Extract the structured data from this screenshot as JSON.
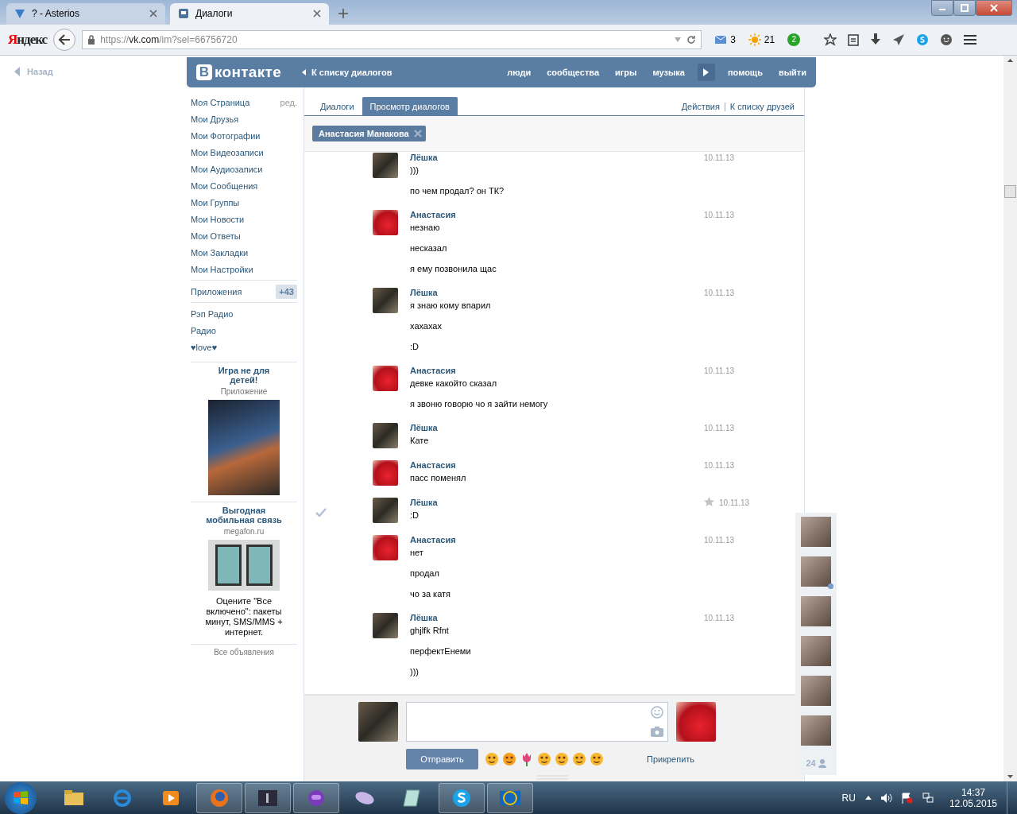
{
  "browser": {
    "tabs": [
      {
        "title": "? - Asterios",
        "selected": false
      },
      {
        "title": "Диалоги",
        "selected": true
      }
    ],
    "logo": "Яндекс",
    "url": "https://**vk.com**/im?sel=66756720",
    "counters": [
      {
        "kind": "mail",
        "value": "3"
      },
      {
        "kind": "weather",
        "value": "21"
      },
      {
        "kind": "badge",
        "value": "2"
      }
    ]
  },
  "back_link": "Назад",
  "header": {
    "logo_letter": "В",
    "logo_text": "контакте",
    "back": "К списку диалогов",
    "nav": [
      "люди",
      "сообщества",
      "игры",
      "музыка"
    ],
    "nav_after": [
      "помощь",
      "выйти"
    ]
  },
  "sidebar": {
    "items": [
      "Моя Страница",
      "Мои Друзья",
      "Мои Фотографии",
      "Мои Видеозаписи",
      "Мои Аудиозаписи",
      "Мои Сообщения",
      "Мои Группы",
      "Мои Новости",
      "Мои Ответы",
      "Мои Закладки",
      "Мои Настройки"
    ],
    "edit": "ред.",
    "apps": "Приложения",
    "apps_count": "+43",
    "extra": [
      "Рэп Радио",
      "Радио",
      "♥love♥"
    ],
    "ads": [
      {
        "title": "Игра не для детей!",
        "source": "Приложение"
      },
      {
        "title": "Выгодная мобильная связь",
        "source": "megafon.ru",
        "text": "Оцените \"Все включено\": пакеты минут, SMS/MMS + интернет."
      }
    ],
    "all_ads": "Все объявления"
  },
  "tabs": [
    {
      "label": "Диалоги",
      "selected": false
    },
    {
      "label": "Просмотр диалогов",
      "selected": true
    }
  ],
  "actions": [
    "Действия",
    "К списку друзей"
  ],
  "recipient": "Анастасия Манакова",
  "messages": [
    {
      "kind": "self",
      "sender": "Лёшка",
      "date": "10.11.13",
      "selected": false,
      "important": false,
      "texts": [
        ")))",
        "по чем продал? он ТК?"
      ]
    },
    {
      "kind": "peer",
      "sender": "Анастасия",
      "date": "10.11.13",
      "selected": false,
      "important": false,
      "texts": [
        "незнаю",
        "несказал",
        "я ему позвонила щас"
      ]
    },
    {
      "kind": "self",
      "sender": "Лёшка",
      "date": "10.11.13",
      "selected": false,
      "important": false,
      "texts": [
        "я знаю кому впарил",
        "хахахах",
        ":D"
      ]
    },
    {
      "kind": "peer",
      "sender": "Анастасия",
      "date": "10.11.13",
      "selected": false,
      "important": false,
      "texts": [
        "девке какойто сказал",
        "я звоню говорю чо я зайти немогу"
      ]
    },
    {
      "kind": "self",
      "sender": "Лёшка",
      "date": "10.11.13",
      "selected": false,
      "important": false,
      "texts": [
        "Кате"
      ]
    },
    {
      "kind": "peer",
      "sender": "Анастасия",
      "date": "10.11.13",
      "selected": false,
      "important": false,
      "texts": [
        "пасс поменял"
      ]
    },
    {
      "kind": "self",
      "sender": "Лёшка",
      "date": "10.11.13",
      "selected": true,
      "important": true,
      "texts": [
        ":D"
      ]
    },
    {
      "kind": "peer",
      "sender": "Анастасия",
      "date": "10.11.13",
      "selected": false,
      "important": false,
      "texts": [
        "нет",
        "продал",
        "чо за катя"
      ]
    },
    {
      "kind": "self",
      "sender": "Лёшка",
      "date": "10.11.13",
      "selected": false,
      "important": false,
      "texts": [
        "ghjlfk Rfnt",
        "перфектЕнеми",
        ")))"
      ]
    }
  ],
  "composer": {
    "send": "Отправить",
    "attach": "Прикрепить"
  },
  "friends": {
    "items": [
      {
        "online": false
      },
      {
        "online": true
      },
      {
        "online": false
      },
      {
        "online": false
      },
      {
        "online": false
      },
      {
        "online": false
      }
    ],
    "count": "24"
  },
  "taskbar": {
    "apps": [
      {
        "kind": "folder",
        "running": false
      },
      {
        "kind": "ie",
        "running": false
      },
      {
        "kind": "media",
        "running": false
      },
      {
        "kind": "firefox",
        "running": true
      },
      {
        "kind": "game",
        "running": true
      },
      {
        "kind": "purple",
        "running": true
      },
      {
        "kind": "mouse",
        "running": false
      },
      {
        "kind": "notepad",
        "running": false
      },
      {
        "kind": "skype",
        "running": true
      },
      {
        "kind": "it",
        "running": true
      }
    ],
    "lang": "RU",
    "time": "14:37",
    "date": "12.05.2015"
  }
}
